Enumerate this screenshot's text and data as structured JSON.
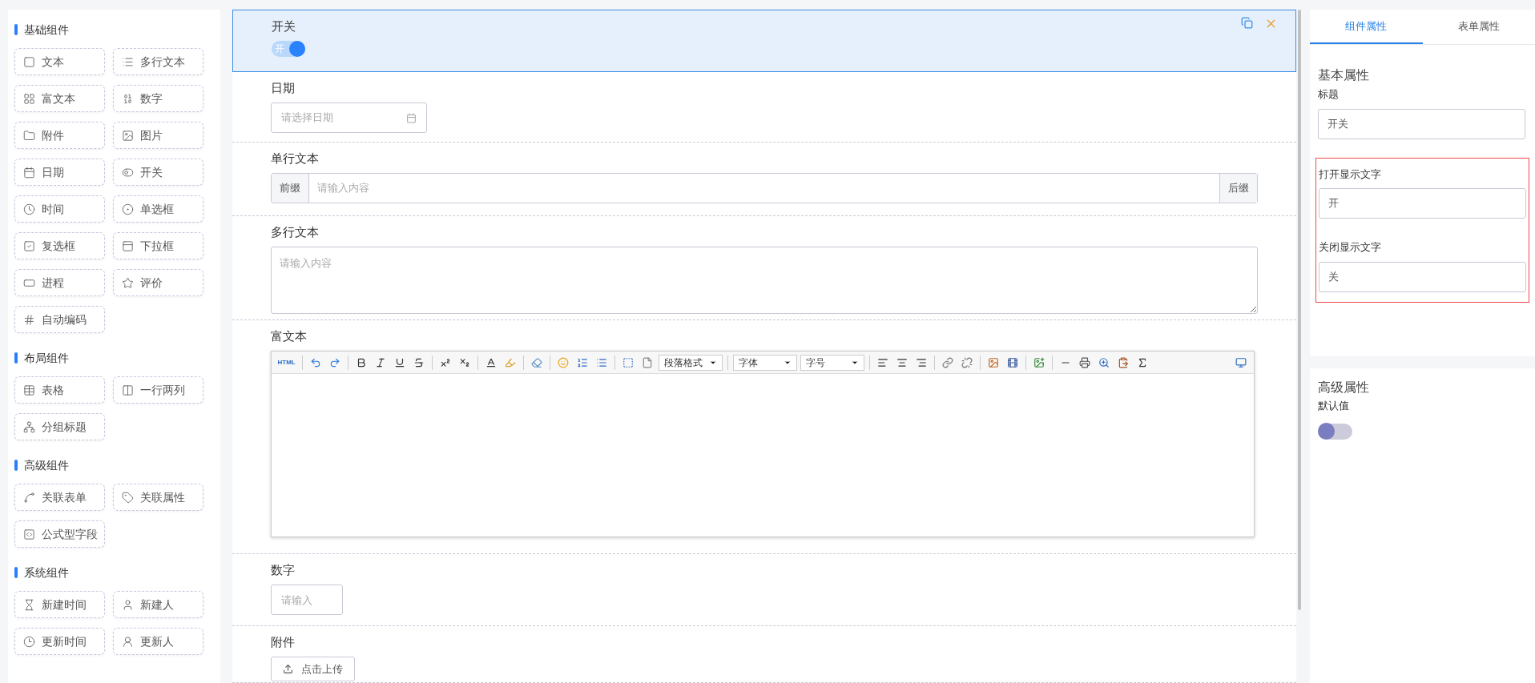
{
  "sidebar": {
    "groups": [
      {
        "title": "基础组件",
        "items": [
          "文本",
          "多行文本",
          "富文本",
          "数字",
          "附件",
          "图片",
          "日期",
          "开关",
          "时间",
          "单选框",
          "复选框",
          "下拉框",
          "进程",
          "评价",
          "自动编码"
        ]
      },
      {
        "title": "布局组件",
        "items": [
          "表格",
          "一行两列",
          "分组标题"
        ]
      },
      {
        "title": "高级组件",
        "items": [
          "关联表单",
          "关联属性",
          "公式型字段"
        ]
      },
      {
        "title": "系统组件",
        "items": [
          "新建时间",
          "新建人",
          "更新时间",
          "更新人"
        ]
      }
    ]
  },
  "canvas": {
    "fields": [
      {
        "kind": "switch",
        "label": "开关",
        "selected": true,
        "on": true,
        "on_text": "开"
      },
      {
        "kind": "date",
        "label": "日期",
        "selected": false,
        "placeholder": "请选择日期"
      },
      {
        "kind": "affix",
        "label": "单行文本",
        "selected": false,
        "prefix": "前缀",
        "placeholder": "请输入内容",
        "suffix": "后缀"
      },
      {
        "kind": "textarea",
        "label": "多行文本",
        "selected": false,
        "placeholder": "请输入内容"
      },
      {
        "kind": "richtext",
        "label": "富文本",
        "selected": false,
        "html_label": "HTML",
        "selects": [
          "段落格式",
          "字体",
          "字号"
        ]
      },
      {
        "kind": "number",
        "label": "数字",
        "selected": false,
        "placeholder": "请输入"
      },
      {
        "kind": "upload",
        "label": "附件",
        "selected": false,
        "button": "点击上传"
      }
    ]
  },
  "properties": {
    "tabs": [
      {
        "label": "组件属性",
        "selected": true
      },
      {
        "label": "表单属性",
        "selected": false
      }
    ],
    "basic": {
      "title": "基本属性",
      "title_field": {
        "label": "标题",
        "value": "开关"
      },
      "switch_texts": {
        "highlighted": true,
        "fields": [
          {
            "label": "打开显示文字",
            "value": "开"
          },
          {
            "label": "关闭显示文字",
            "value": "关"
          }
        ]
      }
    },
    "advanced": {
      "title": "高级属性",
      "default_label": "默认值",
      "default_on": false
    }
  }
}
